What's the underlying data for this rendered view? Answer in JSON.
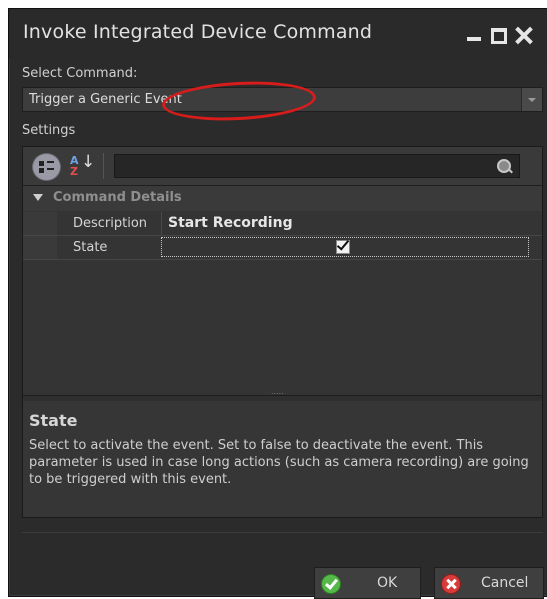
{
  "window": {
    "title": "Invoke Integrated Device Command",
    "controls": [
      "minimize-icon",
      "maximize-icon",
      "close-icon"
    ]
  },
  "select_command": {
    "label": "Select Command:",
    "value": "Trigger a Generic Event"
  },
  "settings": {
    "label": "Settings",
    "toolbar": {
      "icons": [
        "categorized-view-icon",
        "alphabetical-sort-icon",
        "search-icon"
      ],
      "sort_glyph_top": "A",
      "sort_glyph_bottom": "Z",
      "sort_arrow": "↓",
      "search_value": ""
    },
    "category": {
      "name": "Command Details",
      "properties": [
        {
          "name": "Description",
          "value": "Start Recording"
        },
        {
          "name": "State",
          "value": "checked"
        }
      ]
    },
    "help": {
      "title": "State",
      "text": "Select to activate the event. Set to false to deactivate the event. This parameter is used in case long actions (such as camera recording) are going to be triggered with this event."
    }
  },
  "buttons": {
    "ok": "OK",
    "cancel": "Cancel"
  },
  "colors": {
    "window_bg": "#2b2b2b",
    "annotation_circle": "#d81c1c",
    "ok_icon": "#56b848",
    "cancel_icon": "#d93a3a"
  }
}
